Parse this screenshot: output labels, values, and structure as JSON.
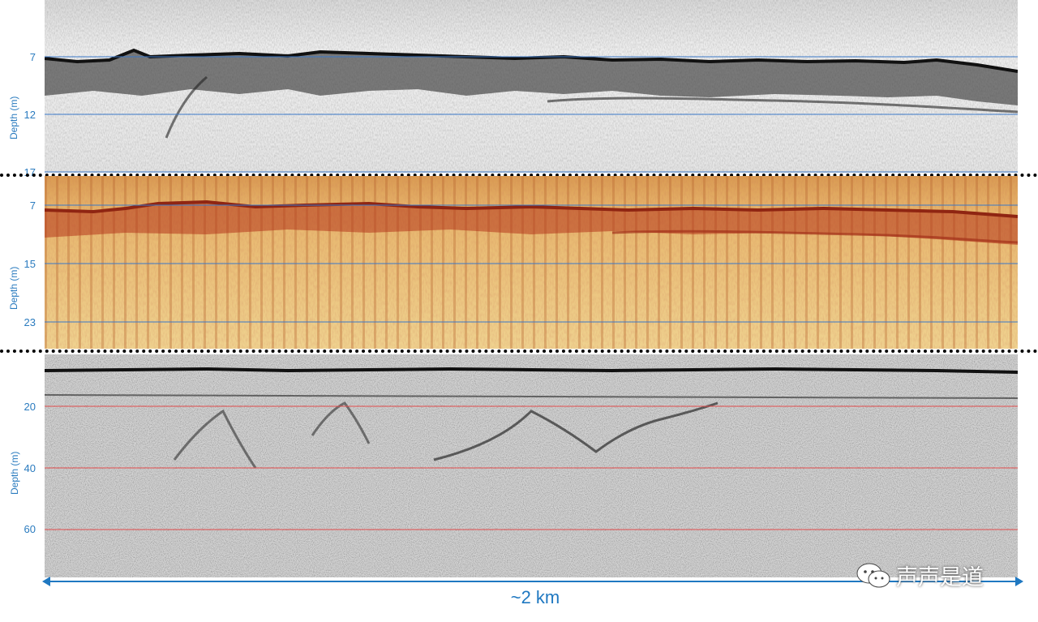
{
  "panels": [
    {
      "id": "top",
      "axis_title": "Depth (m)",
      "ticks": [
        "7",
        "12",
        "17"
      ],
      "colors": {
        "background": "#e9e9e9",
        "ink": "#202020",
        "grid": "#3a78c8"
      }
    },
    {
      "id": "middle",
      "axis_title": "Depth (m)",
      "ticks": [
        "7",
        "15",
        "23"
      ],
      "colors": {
        "background": "#e8c07a",
        "ink": "#a8321c",
        "grid": "#3a78c8"
      }
    },
    {
      "id": "bottom",
      "axis_title": "Depth (m)",
      "ticks": [
        "20",
        "40",
        "60"
      ],
      "colors": {
        "background": "#cfcfcf",
        "ink": "#111111",
        "grid": "#e04a4a"
      }
    }
  ],
  "scale_bar": {
    "label": "~2 km",
    "color": "#1f78c1"
  },
  "watermark": {
    "text": "声声是道",
    "icon": "wechat-icon"
  }
}
